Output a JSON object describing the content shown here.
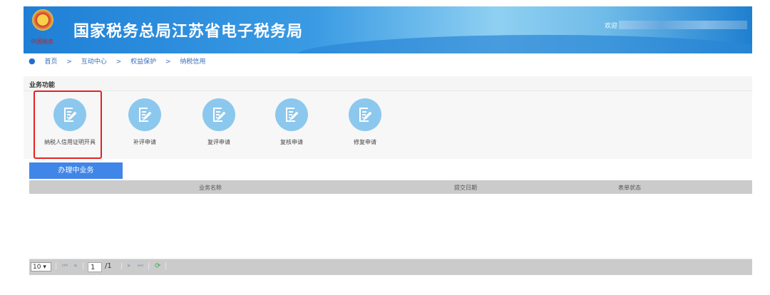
{
  "header": {
    "title": "国家税务总局江苏省电子税务局",
    "emblem_text": "中国税务",
    "welcome": "欢迎"
  },
  "breadcrumb": [
    "首页",
    ">",
    "互动中心",
    ">",
    "权益保护",
    ">",
    "纳税信用"
  ],
  "section": {
    "title": "业务功能"
  },
  "functions": [
    {
      "label": "纳税人信用证明开具",
      "icon": "edit-document-icon"
    },
    {
      "label": "补评申请",
      "icon": "edit-document-icon"
    },
    {
      "label": "复评申请",
      "icon": "edit-document-icon"
    },
    {
      "label": "复核申请",
      "icon": "edit-document-icon"
    },
    {
      "label": "修复申请",
      "icon": "edit-document-icon"
    }
  ],
  "tab": {
    "label": "办理中业务"
  },
  "table": {
    "columns": [
      "业务名称",
      "提交日期",
      "表单状态"
    ],
    "rows": []
  },
  "pager": {
    "page_size": "10",
    "page": "1",
    "total": "/1"
  },
  "colors": {
    "accent": "#3f86e8",
    "highlight": "#e52222",
    "icon_bg": "#8cc8ee"
  }
}
